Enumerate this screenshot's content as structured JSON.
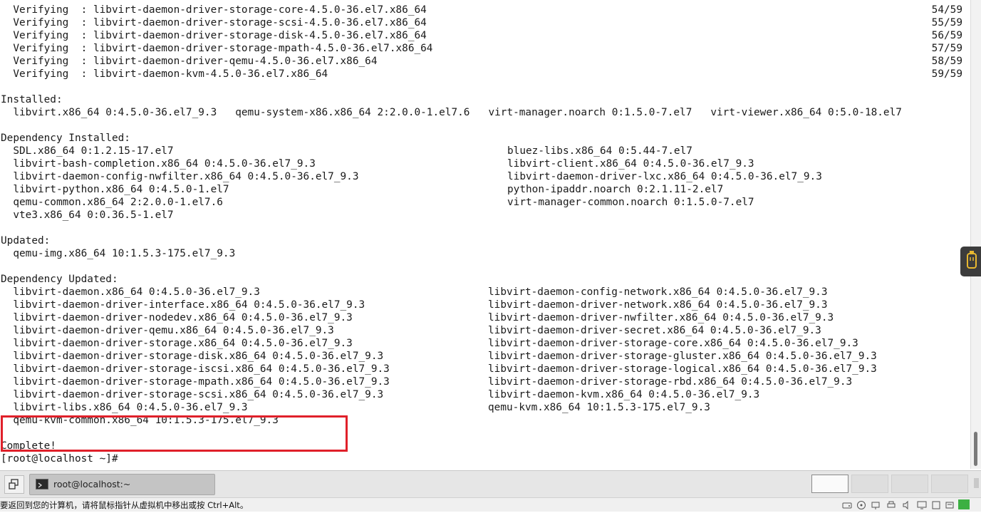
{
  "terminal": {
    "verifying": [
      {
        "text": "  Verifying  : libvirt-daemon-driver-storage-core-4.5.0-36.el7.x86_64",
        "ratio": "54/59"
      },
      {
        "text": "  Verifying  : libvirt-daemon-driver-storage-scsi-4.5.0-36.el7.x86_64",
        "ratio": "55/59"
      },
      {
        "text": "  Verifying  : libvirt-daemon-driver-storage-disk-4.5.0-36.el7.x86_64",
        "ratio": "56/59"
      },
      {
        "text": "  Verifying  : libvirt-daemon-driver-storage-mpath-4.5.0-36.el7.x86_64",
        "ratio": "57/59"
      },
      {
        "text": "  Verifying  : libvirt-daemon-driver-qemu-4.5.0-36.el7.x86_64",
        "ratio": "58/59"
      },
      {
        "text": "  Verifying  : libvirt-daemon-kvm-4.5.0-36.el7.x86_64",
        "ratio": "59/59"
      }
    ],
    "installed_header": "Installed:",
    "installed_line": "  libvirt.x86_64 0:4.5.0-36.el7_9.3   qemu-system-x86.x86_64 2:2.0.0-1.el7.6   virt-manager.noarch 0:1.5.0-7.el7   virt-viewer.x86_64 0:5.0-18.el7",
    "dep_installed_header": "Dependency Installed:",
    "dep_installed": [
      [
        "  SDL.x86_64 0:1.2.15-17.el7",
        "bluez-libs.x86_64 0:5.44-7.el7"
      ],
      [
        "  libvirt-bash-completion.x86_64 0:4.5.0-36.el7_9.3",
        "libvirt-client.x86_64 0:4.5.0-36.el7_9.3"
      ],
      [
        "  libvirt-daemon-config-nwfilter.x86_64 0:4.5.0-36.el7_9.3",
        "libvirt-daemon-driver-lxc.x86_64 0:4.5.0-36.el7_9.3"
      ],
      [
        "  libvirt-python.x86_64 0:4.5.0-1.el7",
        "python-ipaddr.noarch 0:2.1.11-2.el7"
      ],
      [
        "  qemu-common.x86_64 2:2.0.0-1.el7.6",
        "virt-manager-common.noarch 0:1.5.0-7.el7"
      ],
      [
        "  vte3.x86_64 0:0.36.5-1.el7",
        ""
      ]
    ],
    "updated_header": "Updated:",
    "updated_line": "  qemu-img.x86_64 10:1.5.3-175.el7_9.3",
    "dep_updated_header": "Dependency Updated:",
    "dep_updated": [
      [
        "  libvirt-daemon.x86_64 0:4.5.0-36.el7_9.3",
        "libvirt-daemon-config-network.x86_64 0:4.5.0-36.el7_9.3"
      ],
      [
        "  libvirt-daemon-driver-interface.x86_64 0:4.5.0-36.el7_9.3",
        "libvirt-daemon-driver-network.x86_64 0:4.5.0-36.el7_9.3"
      ],
      [
        "  libvirt-daemon-driver-nodedev.x86_64 0:4.5.0-36.el7_9.3",
        "libvirt-daemon-driver-nwfilter.x86_64 0:4.5.0-36.el7_9.3"
      ],
      [
        "  libvirt-daemon-driver-qemu.x86_64 0:4.5.0-36.el7_9.3",
        "libvirt-daemon-driver-secret.x86_64 0:4.5.0-36.el7_9.3"
      ],
      [
        "  libvirt-daemon-driver-storage.x86_64 0:4.5.0-36.el7_9.3",
        "libvirt-daemon-driver-storage-core.x86_64 0:4.5.0-36.el7_9.3"
      ],
      [
        "  libvirt-daemon-driver-storage-disk.x86_64 0:4.5.0-36.el7_9.3",
        "libvirt-daemon-driver-storage-gluster.x86_64 0:4.5.0-36.el7_9.3"
      ],
      [
        "  libvirt-daemon-driver-storage-iscsi.x86_64 0:4.5.0-36.el7_9.3",
        "libvirt-daemon-driver-storage-logical.x86_64 0:4.5.0-36.el7_9.3"
      ],
      [
        "  libvirt-daemon-driver-storage-mpath.x86_64 0:4.5.0-36.el7_9.3",
        "libvirt-daemon-driver-storage-rbd.x86_64 0:4.5.0-36.el7_9.3"
      ],
      [
        "  libvirt-daemon-driver-storage-scsi.x86_64 0:4.5.0-36.el7_9.3",
        "libvirt-daemon-kvm.x86_64 0:4.5.0-36.el7_9.3"
      ],
      [
        "  libvirt-libs.x86_64 0:4.5.0-36.el7_9.3",
        "qemu-kvm.x86_64 10:1.5.3-175.el7_9.3"
      ],
      [
        "  qemu-kvm-common.x86_64 10:1.5.3-175.el7_9.3",
        ""
      ]
    ],
    "complete": "Complete!",
    "prompt": "[root@localhost ~]#"
  },
  "taskbar": {
    "task_label": "root@localhost:~",
    "show_desktop_icon": "show-desktop-icon",
    "terminal_icon": "terminal-icon"
  },
  "statusbar": {
    "message": "要返回到您的计算机，请将鼠标指针从虚拟机中移出或按 Ctrl+Alt。"
  },
  "colors": {
    "highlight": "#e0202a",
    "terminal_bg": "#ffffff",
    "text": "#1a1a1a"
  }
}
